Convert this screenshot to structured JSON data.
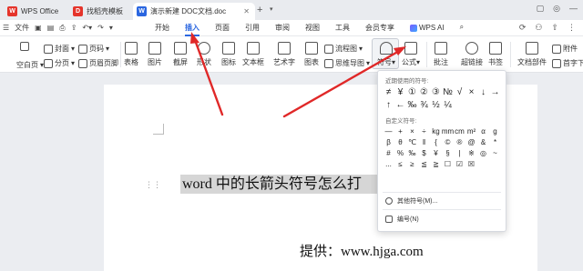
{
  "tabs": {
    "items": [
      {
        "label": "WPS Office",
        "icon": "W",
        "color": "#e5342b"
      },
      {
        "label": "找稻壳模板",
        "icon": "D",
        "color": "#e5342b"
      },
      {
        "label": "演示新建 DOC文档.doc",
        "icon": "W",
        "color": "#2a66e0"
      }
    ]
  },
  "menubar": {
    "file_label": "文件",
    "tabs": [
      {
        "label": "开始"
      },
      {
        "label": "插入"
      },
      {
        "label": "页面"
      },
      {
        "label": "引用"
      },
      {
        "label": "审阅"
      },
      {
        "label": "视图"
      },
      {
        "label": "工具"
      },
      {
        "label": "会员专享"
      },
      {
        "label": "WPS AI"
      }
    ]
  },
  "ribbon": {
    "blank_page": "空白页",
    "cover": "封面",
    "section": "分页",
    "pagebreak": "页码",
    "header_footer": "页眉页脚",
    "table": "表格",
    "picture": "图片",
    "screenshot": "截屏",
    "shape": "形状",
    "icon": "图标",
    "textbox": "文本框",
    "wordart": "艺术字",
    "chart": "图表",
    "flowchart": "流程图",
    "mindmap": "思维导图",
    "symbol": "符号",
    "formula": "公式",
    "comment": "批注",
    "hyperlink": "超链接",
    "bookmark": "书签",
    "doc_parts": "文档部件",
    "attachment": "附件",
    "dropcap": "首字下沉"
  },
  "dropdown": {
    "recent_title": "近期使用的符号:",
    "recent": [
      "≠",
      "¥",
      "①",
      "②",
      "③",
      "№",
      "√",
      "×",
      "↓",
      "→",
      "↑",
      "←",
      "‰",
      "¾",
      "½",
      "¼"
    ],
    "custom_title": "自定义符号:",
    "custom": [
      "—",
      "+",
      "×",
      "÷",
      "kg",
      "mm",
      "cm",
      "m²",
      "α",
      "g",
      "β",
      "θ",
      "℃",
      "‖",
      "{",
      "©",
      "®",
      "@",
      "&",
      "*",
      "#",
      "%",
      "‰",
      "$",
      "¥",
      "§",
      "|",
      "※",
      "◎",
      "~",
      "...",
      "≤",
      "≥",
      "≦",
      "≧",
      "☐",
      "☑",
      "☒"
    ],
    "more_symbols": "其他符号(M)...",
    "number": "编号(N)"
  },
  "document": {
    "heading": "word 中的长箭头符号怎么打",
    "credit": "提供：www.hjga.com"
  }
}
